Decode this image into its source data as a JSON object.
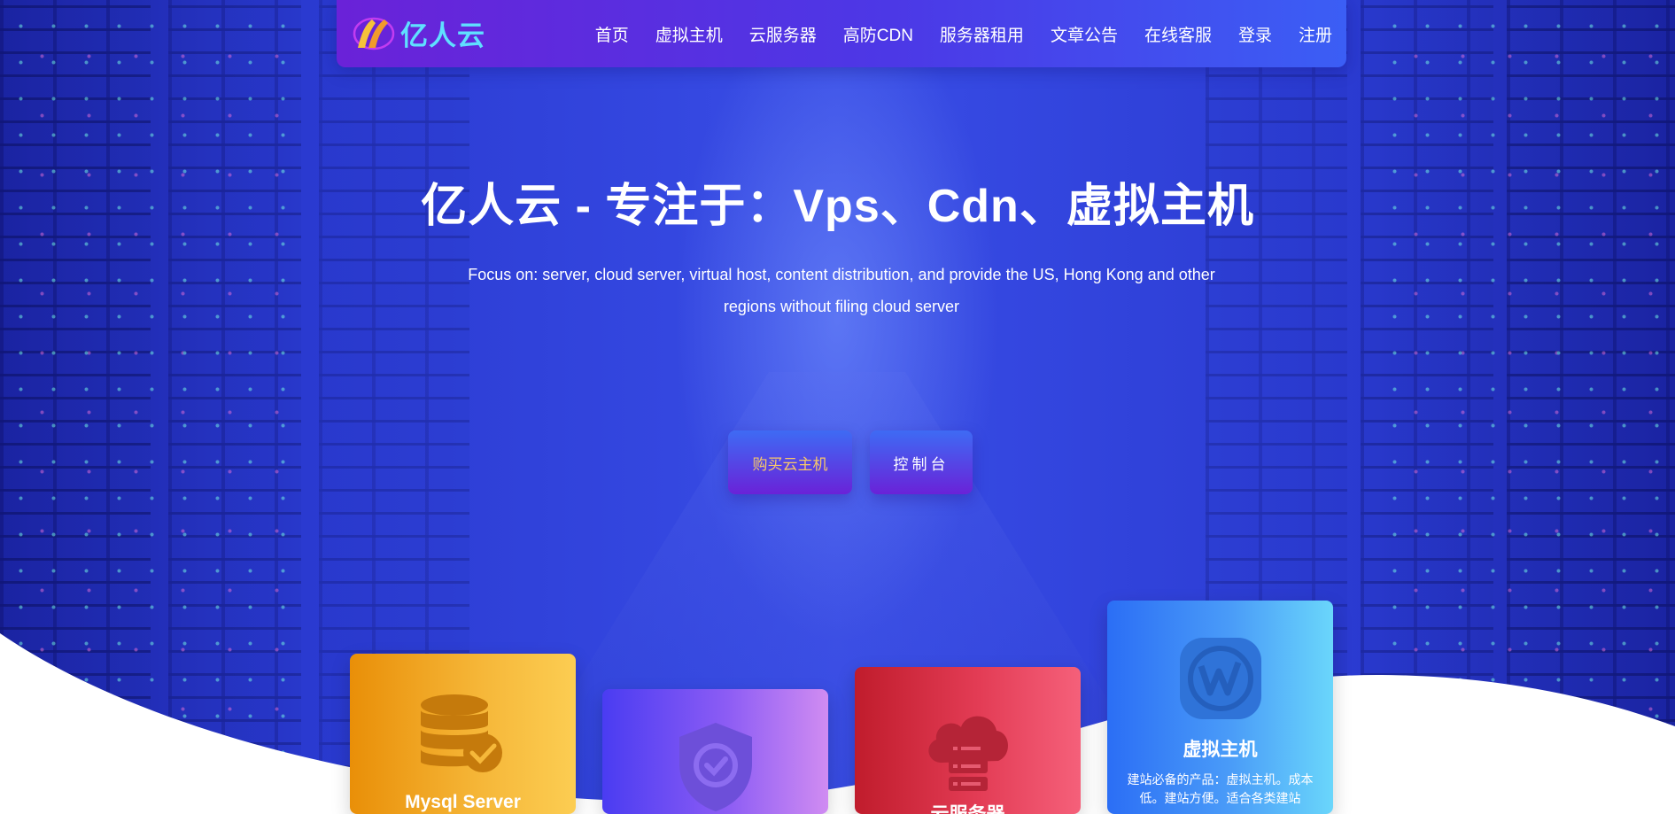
{
  "brand": {
    "name": "亿人云",
    "logo_icon": "logo-icon"
  },
  "nav": {
    "items": [
      {
        "label": "首页"
      },
      {
        "label": "虚拟主机"
      },
      {
        "label": "云服务器"
      },
      {
        "label": "高防CDN"
      },
      {
        "label": "服务器租用"
      },
      {
        "label": "文章公告"
      },
      {
        "label": "在线客服"
      },
      {
        "label": "登录"
      },
      {
        "label": "注册"
      }
    ]
  },
  "hero": {
    "title": "亿人云 - 专注于：Vps、Cdn、虚拟主机",
    "subtitle": "Focus on: server, cloud server, virtual host, content distribution, and provide the US, Hong Kong and other regions without filing cloud server",
    "buy_button": "购买云主机",
    "console_button": "控制台"
  },
  "cards": [
    {
      "title": "Mysql Server",
      "icon": "database-check-icon",
      "color": "#f0a21c"
    },
    {
      "title": "",
      "icon": "shield-check-icon",
      "color": "#7a52f4"
    },
    {
      "title": "云服务器",
      "icon": "cloud-server-icon",
      "color": "#d9304a"
    },
    {
      "title": "虚拟主机",
      "description": "建站必备的产品：虚拟主机。成本低。建站方便。适合各类建站",
      "icon": "wordpress-icon",
      "color": "#4a9cf8"
    }
  ],
  "colors": {
    "navbar_start": "#6a22d8",
    "navbar_end": "#3b5ef5",
    "logo_text": "#5fe0ff",
    "buy_text": "#f7c86a",
    "hero_bg": "#3447e0"
  }
}
